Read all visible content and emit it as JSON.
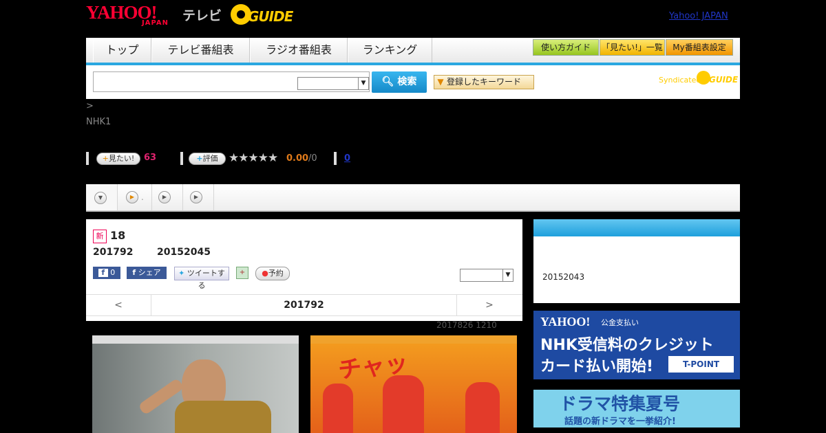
{
  "header": {
    "yahoo_logo": "YAHOO!",
    "japan_logo": "JAPAN",
    "tv_logo": "テレビ",
    "gguide_logo": "GUIDE",
    "yahoo_japan_link": "Yahoo! JAPAN"
  },
  "nav": {
    "tabs": [
      "トップ",
      "テレビ番組表",
      "ラジオ番組表",
      "ランキング"
    ],
    "buttons": [
      "使い方ガイド",
      "「見たい!」一覧",
      "My番組表設定"
    ]
  },
  "search": {
    "input_value": "",
    "select_value": "",
    "search_label": "検索",
    "keyword_label": "登録したキーワード",
    "syndicated": "Syndicated",
    "syndicated_guide": "GUIDE"
  },
  "breadcrumb": ">",
  "channel": "NHK1",
  "stats": {
    "mitai_label": "見たい!",
    "mitai_count": "63",
    "rating_label": "評価",
    "rating_value": "0.00",
    "rating_max": "/0",
    "review_count": "0",
    "stars": "★★★★★"
  },
  "program": {
    "new_badge": "新",
    "title": "18",
    "date_left": "201792",
    "date_right": "20152045",
    "fb_count": "0",
    "share_label": "シェア",
    "tweet_label": "ツイートする",
    "reserve_label": "予約",
    "select_value": "",
    "prev": "<",
    "next": ">",
    "nav_date": "201792",
    "updated": "2017826  1210"
  },
  "side": {
    "text": "20152043"
  },
  "ads": {
    "ad1_brand": "YAHOO!",
    "ad1_sub": "公金支払い",
    "ad1_line1": "NHK受信料のクレジット",
    "ad1_line2": "カード払い開始!",
    "ad1_tpoint": "T-POINT",
    "ad2_title": "ドラマ特集夏号",
    "ad2_sub": "話題の新ドラマを一挙紹介!"
  },
  "photos": {
    "photo2_sign": "チャッ"
  },
  "colors": {
    "accent_blue": "#2aa7e0",
    "yahoo_red": "#ff0033",
    "gguide_yellow": "#ffcc00",
    "count_pink": "#e0226e",
    "rating_orange": "#e07a1a"
  }
}
